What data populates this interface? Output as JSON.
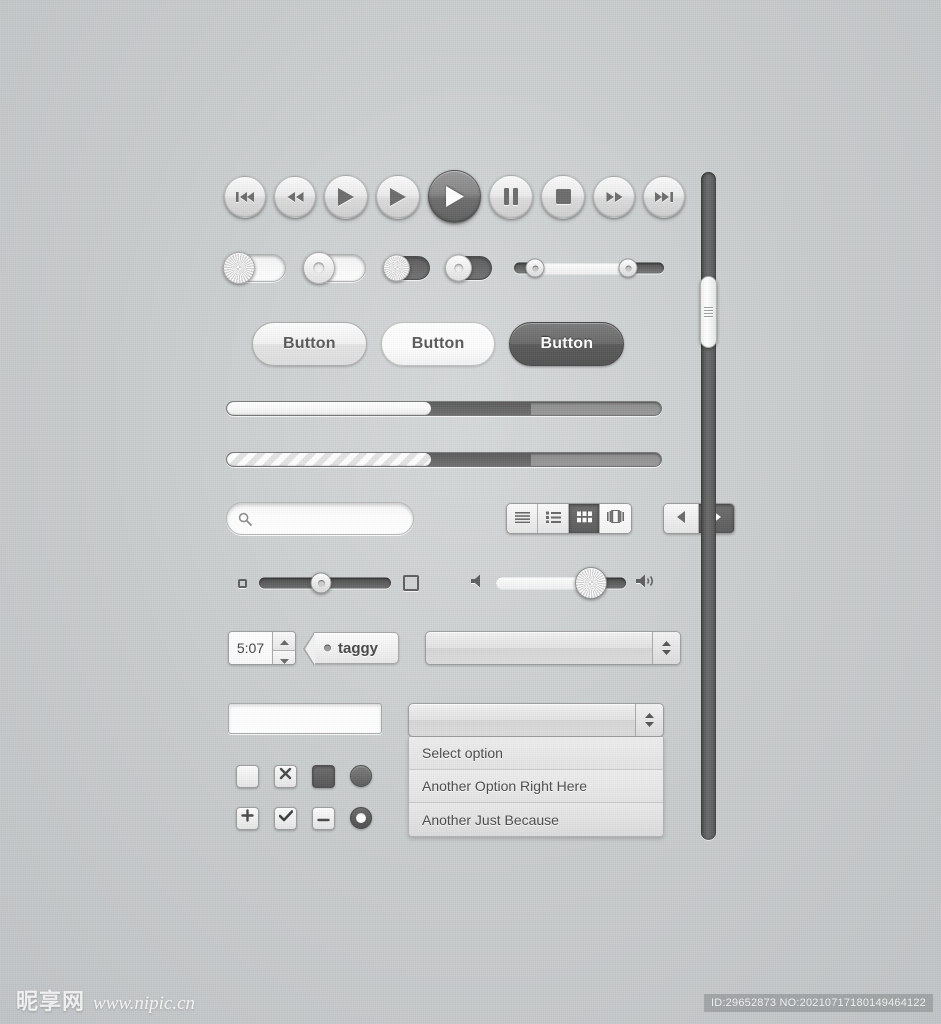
{
  "transport": {
    "buttons": [
      {
        "name": "skip-back-button",
        "icon": "skip-backward-icon",
        "style": "small"
      },
      {
        "name": "rewind-button",
        "icon": "rewind-icon",
        "style": "small"
      },
      {
        "name": "play-button-1",
        "icon": "play-icon",
        "style": "medium"
      },
      {
        "name": "play-button-2",
        "icon": "play-icon",
        "style": "medium"
      },
      {
        "name": "play-button-active",
        "icon": "play-icon",
        "style": "dark-large"
      },
      {
        "name": "pause-button",
        "icon": "pause-icon",
        "style": "medium"
      },
      {
        "name": "stop-button",
        "icon": "stop-icon",
        "style": "medium"
      },
      {
        "name": "fast-forward-button",
        "icon": "fast-forward-icon",
        "style": "small"
      },
      {
        "name": "skip-forward-button",
        "icon": "skip-forward-icon",
        "style": "small"
      }
    ]
  },
  "toggles": [
    {
      "name": "toggle-large-brushed",
      "state": "on",
      "knob": "brushed"
    },
    {
      "name": "toggle-large-ring",
      "state": "on",
      "knob": "ring"
    },
    {
      "name": "toggle-small-brushed",
      "state": "off",
      "knob": "brushed"
    },
    {
      "name": "toggle-small-ring",
      "state": "off",
      "knob": "ring"
    }
  ],
  "range_slider": {
    "name": "range-slider",
    "low_percent": 14,
    "high_percent": 76
  },
  "buttons": [
    {
      "label": "Button",
      "variant": "lite"
    },
    {
      "label": "Button",
      "variant": "white"
    },
    {
      "label": "Button",
      "variant": "dark"
    }
  ],
  "progress_bars": [
    {
      "name": "progress-bar-solid",
      "fill_percent": 47,
      "buffer_percent": 70,
      "striped": false
    },
    {
      "name": "progress-bar-striped",
      "fill_percent": 47,
      "buffer_percent": 70,
      "striped": true
    }
  ],
  "search": {
    "value": "",
    "placeholder": "",
    "icon": "search-icon"
  },
  "segmented_control": {
    "segments": [
      {
        "name": "view-list-icon",
        "active": false
      },
      {
        "name": "view-detail-list-icon",
        "active": false
      },
      {
        "name": "view-grid-icon",
        "active": true
      },
      {
        "name": "view-coverflow-icon",
        "active": false
      }
    ]
  },
  "pager": {
    "previous": {
      "name": "previous-arrow-icon",
      "active": false
    },
    "next": {
      "name": "next-arrow-icon",
      "active": true
    }
  },
  "sliders": {
    "zoom": {
      "name": "zoom-slider",
      "value_percent": 47,
      "min_icon": "small-square-icon",
      "max_icon": "large-square-icon"
    },
    "volume": {
      "name": "volume-slider",
      "value_percent": 73,
      "min_icon": "speaker-mute-icon",
      "max_icon": "speaker-loud-icon"
    }
  },
  "stepper": {
    "name": "time-stepper",
    "value": "5:07",
    "up_icon": "stepper-up-icon",
    "down_icon": "stepper-down-icon"
  },
  "tag": {
    "label": "taggy",
    "dot": "tag-dot-icon"
  },
  "combo_closed": {
    "name": "combo-box-closed",
    "value": "",
    "arrow_icon": "select-updown-icon"
  },
  "text_input": {
    "name": "text-input",
    "value": "",
    "placeholder": ""
  },
  "checkboxes": {
    "row1": [
      {
        "name": "checkbox-empty",
        "type": "checkbox",
        "mark": "none"
      },
      {
        "name": "checkbox-x",
        "type": "checkbox",
        "mark": "x"
      },
      {
        "name": "checkbox-filled",
        "type": "checkbox",
        "mark": "filled"
      },
      {
        "name": "radio-selected-dark",
        "type": "radio",
        "mark": "dark"
      }
    ],
    "row2": [
      {
        "name": "checkbox-plus",
        "type": "checkbox",
        "mark": "plus"
      },
      {
        "name": "checkbox-check",
        "type": "checkbox",
        "mark": "check"
      },
      {
        "name": "checkbox-minus",
        "type": "checkbox",
        "mark": "minus"
      },
      {
        "name": "radio-hollow",
        "type": "radio",
        "mark": "hollow"
      }
    ]
  },
  "select_open": {
    "name": "select-open",
    "value": "",
    "arrow_icon": "select-updown-icon",
    "options": [
      "Select option",
      "Another Option Right Here",
      "Another Just Because"
    ]
  },
  "scrollbar": {
    "name": "vertical-scrollbar",
    "thumb_position_percent": 15,
    "grip_icon": "grip-lines-icon"
  },
  "watermark": {
    "logo_cn": "昵享网",
    "url": "www.nipic.cn",
    "id_text": "ID:29652873 NO:20210717180149464122"
  },
  "colors": {
    "background": "#c9cccd",
    "accent_dark": "#5a5a5a",
    "track_dark": "#5f5f5f",
    "text": "#4c4c4c"
  }
}
